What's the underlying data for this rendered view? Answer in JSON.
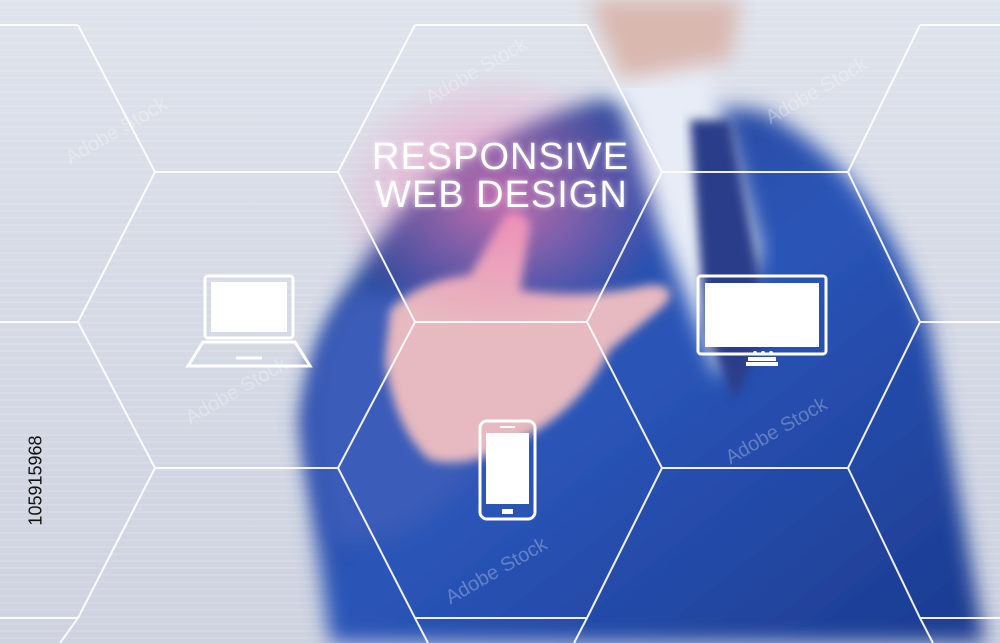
{
  "headline": {
    "line1": "RESPONSIVE",
    "line2": "WEB DESIGN"
  },
  "stock_id": "105915968",
  "watermark": "Adobe Stock",
  "icons": [
    "laptop-icon",
    "smartphone-icon",
    "desktop-monitor-icon"
  ],
  "colors": {
    "hex_lines": "#ffffff",
    "suit": "#2a4a9c",
    "highlight": "#e86fa8"
  }
}
